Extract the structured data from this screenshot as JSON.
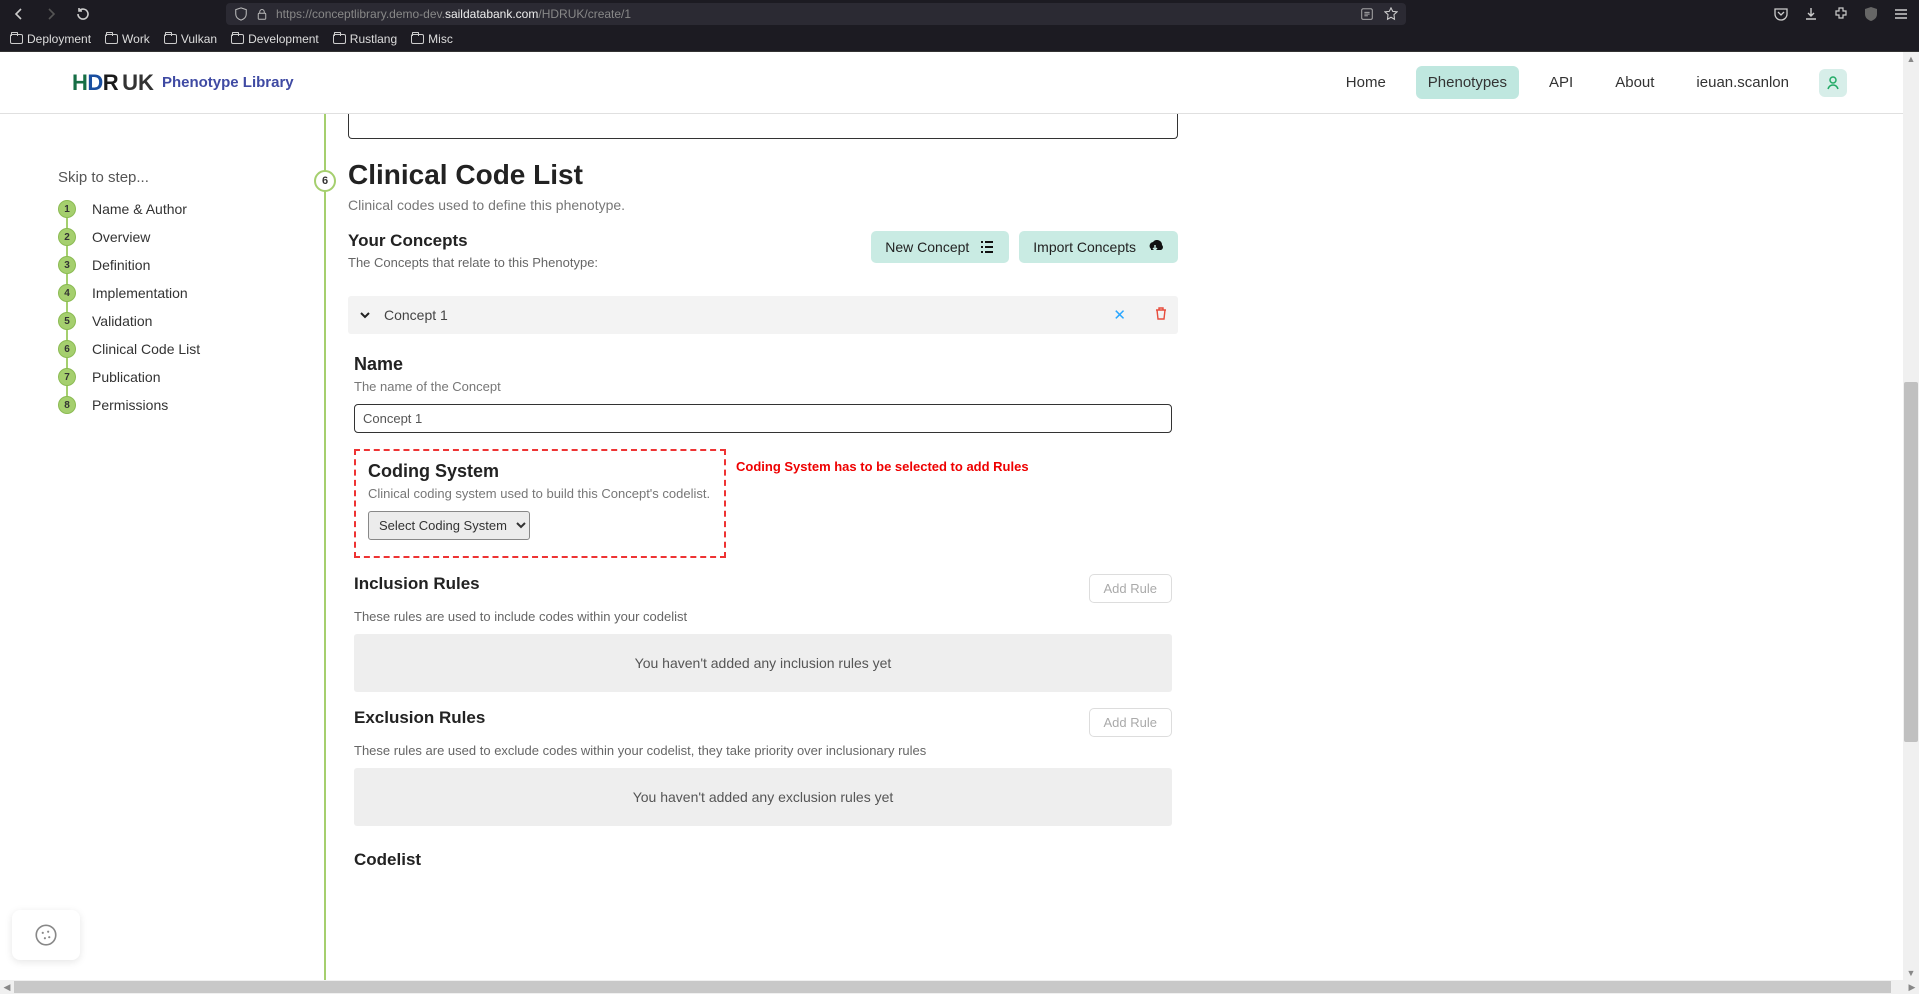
{
  "browser": {
    "url_prefix": "https://conceptlibrary.demo-dev.",
    "url_host": "saildatabank.com",
    "url_path": "/HDRUK/create/1",
    "bookmarks": [
      "Deployment",
      "Work",
      "Vulkan",
      "Development",
      "Rustlang",
      "Misc"
    ]
  },
  "header": {
    "logo_sub": "Phenotype Library",
    "nav": {
      "home": "Home",
      "phenotypes": "Phenotypes",
      "api": "API",
      "about": "About",
      "user": "ieuan.scanlon"
    }
  },
  "sidebar": {
    "title": "Skip to step...",
    "steps": [
      {
        "n": "1",
        "label": "Name & Author"
      },
      {
        "n": "2",
        "label": "Overview"
      },
      {
        "n": "3",
        "label": "Definition"
      },
      {
        "n": "4",
        "label": "Implementation"
      },
      {
        "n": "5",
        "label": "Validation"
      },
      {
        "n": "6",
        "label": "Clinical Code List"
      },
      {
        "n": "7",
        "label": "Publication"
      },
      {
        "n": "8",
        "label": "Permissions"
      }
    ]
  },
  "section6": {
    "marker": "6",
    "title": "Clinical Code List",
    "desc": "Clinical codes used to define this phenotype.",
    "your_concepts": {
      "title": "Your Concepts",
      "desc": "The Concepts that relate to this Phenotype:",
      "new_btn": "New Concept",
      "import_btn": "Import Concepts"
    },
    "concept": {
      "title": "Concept 1",
      "name_label": "Name",
      "name_desc": "The name of the Concept",
      "name_value": "Concept 1",
      "coding_label": "Coding System",
      "coding_desc": "Clinical coding system used to build this Concept's codelist.",
      "coding_select": "Select Coding System",
      "coding_warn": "Coding System has to be selected to add Rules",
      "inclusion": {
        "title": "Inclusion Rules",
        "desc": "These rules are used to include codes within your codelist",
        "empty": "You haven't added any inclusion rules yet",
        "add": "Add Rule"
      },
      "exclusion": {
        "title": "Exclusion Rules",
        "desc": "These rules are used to exclude codes within your codelist, they take priority over inclusionary rules",
        "empty": "You haven't added any exclusion rules yet",
        "add": "Add Rule"
      },
      "codelist": "Codelist"
    }
  }
}
